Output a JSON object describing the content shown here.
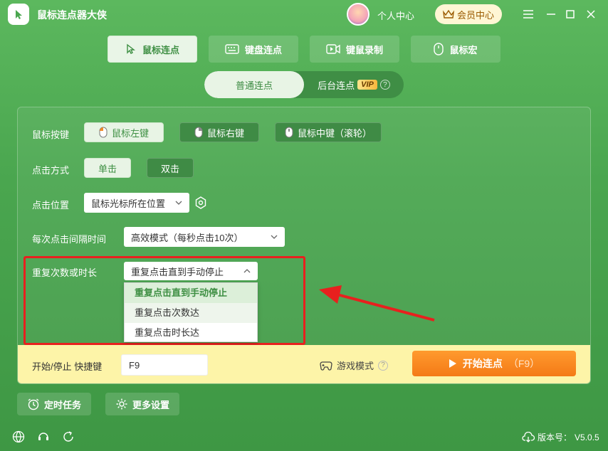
{
  "app": {
    "title": "鼠标连点器大侠",
    "user_center": "个人中心",
    "vip_center": "会员中心"
  },
  "window_controls": [
    "menu-icon",
    "minimize-icon",
    "maximize-icon",
    "close-icon"
  ],
  "main_tabs": [
    {
      "label": "鼠标连点",
      "icon": "cursor-icon",
      "active": true
    },
    {
      "label": "键盘连点",
      "icon": "keyboard-icon",
      "active": false
    },
    {
      "label": "键鼠录制",
      "icon": "record-icon",
      "active": false
    },
    {
      "label": "鼠标宏",
      "icon": "mouse-icon",
      "active": false
    }
  ],
  "sub_tabs": {
    "normal": "普通连点",
    "background": "后台连点",
    "vip_badge": "VIP",
    "help": "?"
  },
  "settings": {
    "mouse_button": {
      "label": "鼠标按键",
      "options": [
        "鼠标左键",
        "鼠标右键",
        "鼠标中键（滚轮）"
      ],
      "selected": 0
    },
    "click_mode": {
      "label": "点击方式",
      "options": [
        "单击",
        "双击"
      ],
      "selected": 0
    },
    "click_position": {
      "label": "点击位置",
      "value": "鼠标光标所在位置"
    },
    "interval": {
      "label": "每次点击间隔时间",
      "value": "高效模式（每秒点击10次）"
    },
    "repeat": {
      "label": "重复次数或时长",
      "value": "重复点击直到手动停止",
      "options": [
        "重复点击直到手动停止",
        "重复点击次数达",
        "重复点击时长达"
      ]
    }
  },
  "hotkey": {
    "label": "开始/停止 快捷键",
    "value": "F9"
  },
  "game_mode": {
    "label": "游戏模式",
    "help": "?"
  },
  "start_button": {
    "label": "开始连点",
    "hotkey": "（F9）"
  },
  "bottom": {
    "timer": "定时任务",
    "more": "更多设置"
  },
  "version": {
    "label": "版本号：",
    "value": "V5.0.5"
  },
  "colors": {
    "bg": "#4aa64f",
    "accent_orange": "#f47a16",
    "highlight_red": "#e8201e"
  }
}
